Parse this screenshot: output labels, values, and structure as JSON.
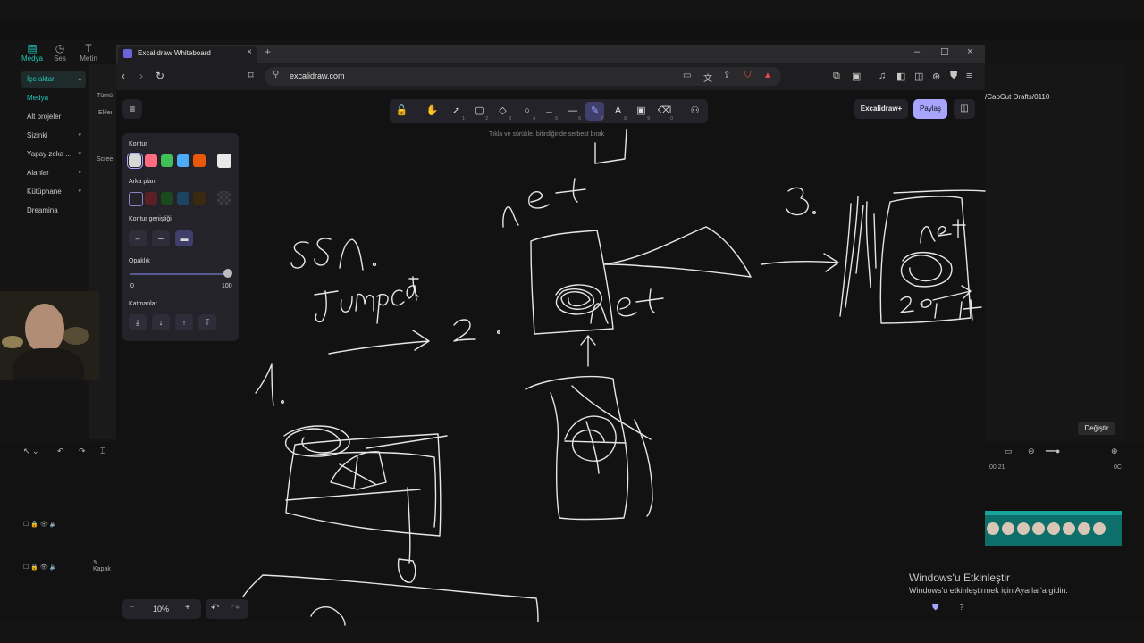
{
  "capcut": {
    "tools": [
      {
        "label": "Medya",
        "icon": "media-icon"
      },
      {
        "label": "Ses",
        "icon": "audio-icon"
      },
      {
        "label": "Metin",
        "icon": "text-icon"
      }
    ],
    "sidebar": [
      {
        "label": "İçe aktar",
        "chev": "▴"
      },
      {
        "label": "Medya",
        "chev": ""
      },
      {
        "label": "Alt projeler",
        "chev": ""
      },
      {
        "label": "Sizinki",
        "chev": "▾"
      },
      {
        "label": "Yapay zeka ...",
        "chev": "▾"
      },
      {
        "label": "Alanlar",
        "chev": "▾"
      },
      {
        "label": "Kütüphane",
        "chev": "▾"
      },
      {
        "label": "Dreamina",
        "chev": ""
      }
    ],
    "panel_tab": "Tümü",
    "panel_btn": "Ekleı",
    "panel_screen": "Scree",
    "path": "/CapCut Drafts/0110",
    "change_button": "Değiştir",
    "timecode_left": "00:21",
    "timecode_right": "0C",
    "track_label": "Kapak"
  },
  "browser": {
    "tab_title": "Excalidraw Whiteboard",
    "url": "excalidraw.com"
  },
  "excalidraw": {
    "hint": "Tıkla ve sürükle, bitirdiğinde serbest bırak",
    "library_button": "Excalidraw+",
    "share_button": "Paylaş",
    "tools": [
      {
        "name": "lock-icon",
        "glyph": "🔓",
        "n": ""
      },
      {
        "name": "hand-icon",
        "glyph": "✋",
        "n": ""
      },
      {
        "name": "select-icon",
        "glyph": "➚",
        "n": "1"
      },
      {
        "name": "rectangle-icon",
        "glyph": "▢",
        "n": "2"
      },
      {
        "name": "diamond-icon",
        "glyph": "◇",
        "n": "3"
      },
      {
        "name": "ellipse-icon",
        "glyph": "○",
        "n": "4"
      },
      {
        "name": "arrow-icon",
        "glyph": "→",
        "n": "5"
      },
      {
        "name": "line-icon",
        "glyph": "—",
        "n": "6"
      },
      {
        "name": "pencil-icon",
        "glyph": "✎",
        "n": "7"
      },
      {
        "name": "text-icon",
        "glyph": "A",
        "n": "8"
      },
      {
        "name": "image-icon",
        "glyph": "▣",
        "n": "9"
      },
      {
        "name": "eraser-icon",
        "glyph": "⌫",
        "n": "0"
      },
      {
        "name": "more-tools-icon",
        "glyph": "⚇",
        "n": ""
      }
    ],
    "props": {
      "stroke_label": "Kontur",
      "stroke_colors": [
        "#d7d7d7",
        "#ff6b81",
        "#40c057",
        "#4dabf7",
        "#e8590c"
      ],
      "stroke_current": "#e9e9e9",
      "background_label": "Arka plan",
      "background_colors": [
        "transparent",
        "#5c1f23",
        "#1b4a1e",
        "#1a4460",
        "#3a2a0f"
      ],
      "stroke_width_label": "Kontur genişliği",
      "opacity_label": "Opaklık",
      "opacity_min": "0",
      "opacity_max": "100",
      "opacity_value": 100,
      "layers_label": "Katmanlar"
    },
    "zoom": "10%",
    "sketch_text": [
      "net",
      "SSA.",
      "Jumpcat",
      "2.",
      "1.",
      "3.",
      "net",
      "net",
      "2.",
      "net"
    ]
  },
  "windows": {
    "activate_title": "Windows'u Etkinleştir",
    "activate_sub": "Windows'u etkinleştirmek için Ayarlar'a gidin."
  }
}
